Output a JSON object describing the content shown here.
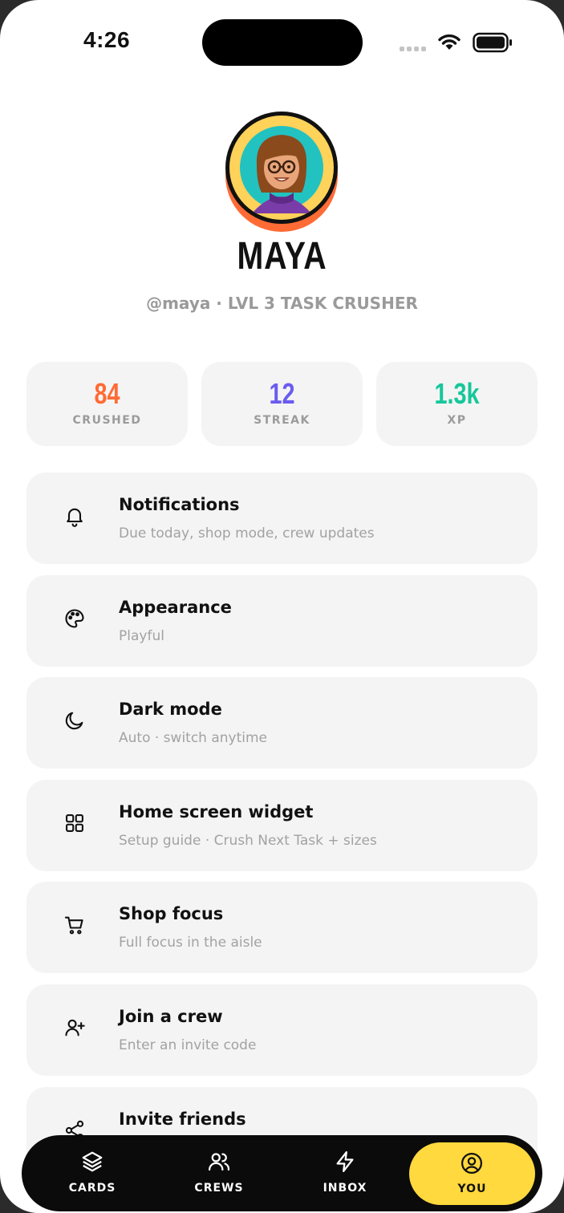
{
  "status": {
    "time": "4:26"
  },
  "profile": {
    "name": "MAYA",
    "handle_line": "@maya · LVL 3 TASK CRUSHER"
  },
  "stats": [
    {
      "value": "84",
      "label": "CRUSHED",
      "color": "#ff6b35"
    },
    {
      "value": "12",
      "label": "STREAK",
      "color": "#6a5cf0"
    },
    {
      "value": "1.3k",
      "label": "XP",
      "color": "#16c79a"
    }
  ],
  "menu": [
    {
      "title": "Notifications",
      "subtitle": "Due today, shop mode, crew updates",
      "icon": "bell-icon"
    },
    {
      "title": "Appearance",
      "subtitle": "Playful",
      "icon": "palette-icon"
    },
    {
      "title": "Dark mode",
      "subtitle": "Auto · switch anytime",
      "icon": "moon-icon"
    },
    {
      "title": "Home screen widget",
      "subtitle": "Setup guide · Crush Next Task + sizes",
      "icon": "grid-icon"
    },
    {
      "title": "Shop focus",
      "subtitle": "Full focus in the aisle",
      "icon": "cart-icon"
    },
    {
      "title": "Join a crew",
      "subtitle": "Enter an invite code",
      "icon": "user-plus-icon"
    },
    {
      "title": "Invite friends",
      "subtitle": "",
      "icon": "share-icon"
    }
  ],
  "nav": [
    {
      "label": "CARDS",
      "icon": "layers-icon"
    },
    {
      "label": "CREWS",
      "icon": "users-icon"
    },
    {
      "label": "INBOX",
      "icon": "bolt-icon"
    },
    {
      "label": "YOU",
      "icon": "user-circle-icon",
      "active": true
    }
  ],
  "colors": {
    "accent": "#ffd93d",
    "avatar_ring": "#ff6b35"
  }
}
